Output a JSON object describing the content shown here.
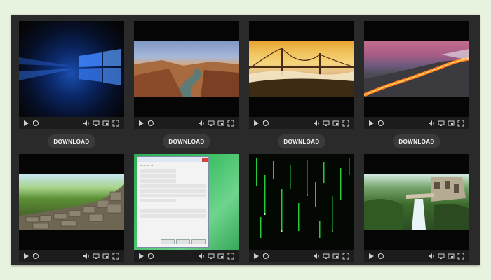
{
  "download_label": "DOWNLOAD",
  "cards": [
    {
      "scene": "windows-wallpaper-thumbnail",
      "has_download": true
    },
    {
      "scene": "canyon-river-thumbnail",
      "has_download": true
    },
    {
      "scene": "golden-gate-fog-thumbnail",
      "has_download": true
    },
    {
      "scene": "lava-flow-thumbnail",
      "has_download": true
    },
    {
      "scene": "stone-wall-thumbnail",
      "has_download": false
    },
    {
      "scene": "taskbar-properties-dialog-thumbnail",
      "has_download": false
    },
    {
      "scene": "matrix-code-rain-thumbnail",
      "has_download": false
    },
    {
      "scene": "waterfall-garden-thumbnail",
      "has_download": false
    }
  ],
  "colors": {
    "page_bg": "#e8f3df",
    "panel_bg": "#2a2a2a",
    "button_bg": "#3a3a3a",
    "button_text": "#f2f2f2"
  },
  "icons": {
    "play": "play-icon",
    "replay": "replay-icon",
    "volume": "volume-icon",
    "screen": "screen-icon",
    "pip": "picture-in-picture-icon",
    "fullscreen": "fullscreen-icon"
  }
}
